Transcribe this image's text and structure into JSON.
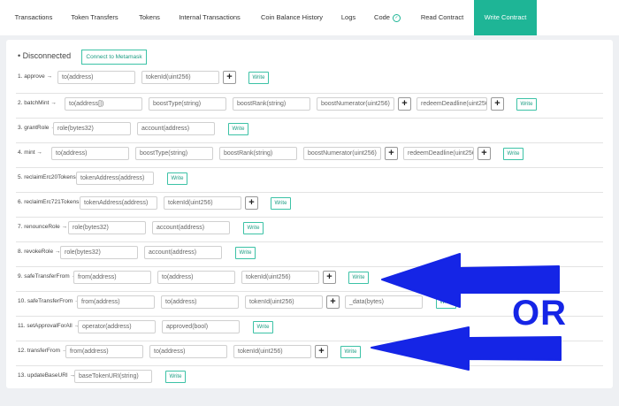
{
  "tabs": [
    {
      "label": "Transactions"
    },
    {
      "label": "Token Transfers"
    },
    {
      "label": "Tokens"
    },
    {
      "label": "Internal Transactions"
    },
    {
      "label": "Coin Balance History"
    },
    {
      "label": "Logs"
    },
    {
      "label": "Code"
    },
    {
      "label": "Read Contract"
    },
    {
      "label": "Write Contract"
    }
  ],
  "status": "Disconnected",
  "connect_label": "Connect to Metamask",
  "write_label": "Write",
  "plus_label": "+",
  "annotation": {
    "text": "OR",
    "color": "#1525e6"
  },
  "colors": {
    "accent": "#1eb596"
  },
  "functions": [
    {
      "label": "1. approve →",
      "inputs": [
        "to(address)",
        "tokenId(uint256)"
      ]
    },
    {
      "label": "2. batchMint →",
      "inputs": [
        "to(address[])",
        "boostType(string)",
        "boostRank(string)",
        "boostNumerator(uint256)",
        "redeemDeadline(uint256)"
      ]
    },
    {
      "label": "3. grantRole →",
      "inputs": [
        "role(bytes32)",
        "account(address)"
      ]
    },
    {
      "label": "4. mint →",
      "inputs": [
        "to(address)",
        "boostType(string)",
        "boostRank(string)",
        "boostNumerator(uint256)",
        "redeemDeadline(uint256)"
      ]
    },
    {
      "label": "5. reclaimErc20Tokens →",
      "inputs": [
        "tokenAddress(address)"
      ]
    },
    {
      "label": "6. reclaimErc721Tokens →",
      "inputs": [
        "tokenAddress(address)",
        "tokenId(uint256)"
      ]
    },
    {
      "label": "7. renounceRole →",
      "inputs": [
        "role(bytes32)",
        "account(address)"
      ]
    },
    {
      "label": "8. revokeRole →",
      "inputs": [
        "role(bytes32)",
        "account(address)"
      ]
    },
    {
      "label": "9. safeTransferFrom →",
      "inputs": [
        "from(address)",
        "to(address)",
        "tokenId(uint256)"
      ]
    },
    {
      "label": "10. safeTransferFrom →",
      "inputs": [
        "from(address)",
        "to(address)",
        "tokenId(uint256)",
        "_data(bytes)"
      ]
    },
    {
      "label": "11. setApprovalForAll →",
      "inputs": [
        "operator(address)",
        "approved(bool)"
      ]
    },
    {
      "label": "12. transferFrom →",
      "inputs": [
        "from(address)",
        "to(address)",
        "tokenId(uint256)"
      ]
    },
    {
      "label": "13. updateBaseURI →",
      "inputs": [
        "baseTokenURI(string)"
      ]
    }
  ]
}
